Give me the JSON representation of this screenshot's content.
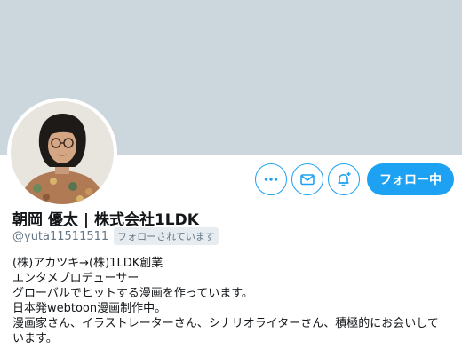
{
  "profile": {
    "display_name": "朝岡 優太 | 株式会社1LDK",
    "handle": "@yuta11511511",
    "follows_you_label": "フォローされています"
  },
  "actions": {
    "more_icon": "more-horizontal-icon",
    "message_icon": "envelope-icon",
    "notify_icon": "bell-plus-icon",
    "following_label": "フォロー中"
  },
  "bio": {
    "lines": [
      "(株)アカツキ→(株)1LDK創業",
      "エンタメプロデューサー",
      "グローバルでヒットする漫画を作っています。",
      "日本発webtoon漫画制作中。",
      "漫画家さん、イラストレーターさん、シナリオライターさん、積極的にお会いして",
      "います。"
    ]
  },
  "colors": {
    "accent": "#1da1f2",
    "banner": "#ccd6dd",
    "text_secondary": "#657786"
  }
}
